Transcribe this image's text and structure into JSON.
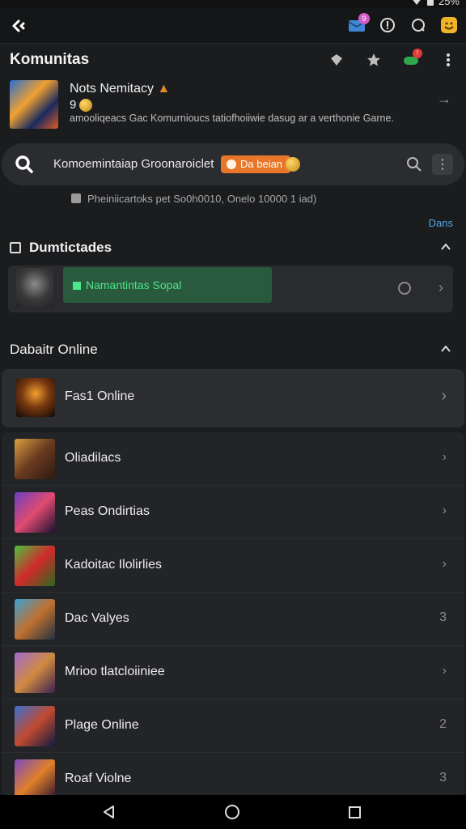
{
  "status_bar": {
    "battery_text": "25%"
  },
  "header": {
    "title": "Komunitas",
    "notification_badge": "9",
    "alert_badge": "!"
  },
  "news": {
    "title": "Nots Nemitacy",
    "subtitle": "9",
    "description": "amooliqeacs Gac Komurnioucs tatiofhoiiwie dasug ar a verthonie Garne."
  },
  "search": {
    "text": "Komoemintaiap Groonaroiclet",
    "chip_label": "Da beian"
  },
  "notice": {
    "text": "Pheiniicartoks pet So0h0010, Onelo 10000 1 iad)"
  },
  "link_right": "Dans",
  "section_community": {
    "title": "Dumtictades",
    "card_label": "Namantintas Sopal"
  },
  "section_online": {
    "title": "Dabaitr Online",
    "featured_label": "Fas1 Online",
    "rows": [
      {
        "label": "Oliadilacs",
        "trail": "›"
      },
      {
        "label": "Peas Ondirtias",
        "trail": "›"
      },
      {
        "label": "Kadoitac Ilolirlies",
        "trail": "›"
      },
      {
        "label": "Dac Valyes",
        "trail": "3"
      },
      {
        "label": "Mrioo tlatcloiiniee",
        "trail": "›"
      },
      {
        "label": "Plage Online",
        "trail": "2"
      },
      {
        "label": "Roaf Violne",
        "trail": "3"
      }
    ]
  },
  "colors": {
    "accent_orange": "#e8762a",
    "accent_green": "#4de58a",
    "link_blue": "#4aa8e0",
    "background": "#1b1c1e"
  },
  "icons": [
    "back-icon",
    "mail-icon",
    "info-icon",
    "chat-icon",
    "profile-icon",
    "shield-icon",
    "star-icon",
    "gamepad-icon",
    "more-vert-icon",
    "search-icon",
    "menu-icon",
    "chevron-up-icon",
    "chevron-right-icon"
  ]
}
